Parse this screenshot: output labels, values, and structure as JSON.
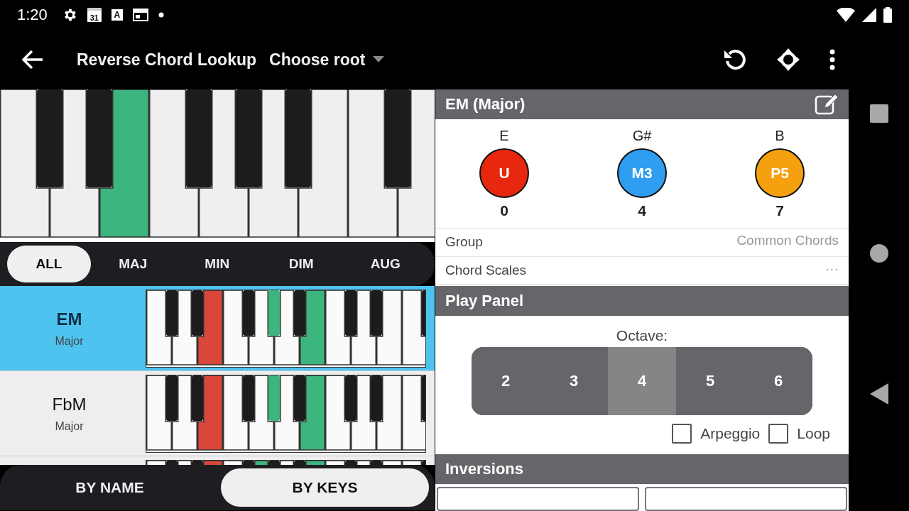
{
  "status_bar": {
    "time": "1:20",
    "calendar_day": "31",
    "keyboard_letter": "A"
  },
  "toolbar": {
    "title": "Reverse Chord Lookup",
    "root_dropdown": "Choose root"
  },
  "piano": {
    "keys": [
      {
        "kind": "white"
      },
      {
        "kind": "black"
      },
      {
        "kind": "white"
      },
      {
        "kind": "black"
      },
      {
        "kind": "white",
        "color": "#3db57f"
      },
      {
        "kind": "white"
      },
      {
        "kind": "black"
      },
      {
        "kind": "white"
      },
      {
        "kind": "black"
      },
      {
        "kind": "white"
      },
      {
        "kind": "black"
      },
      {
        "kind": "white"
      },
      {
        "kind": "white"
      },
      {
        "kind": "black"
      },
      {
        "kind": "white"
      }
    ]
  },
  "filter_tabs": [
    {
      "label": "ALL",
      "selected": true
    },
    {
      "label": "MAJ",
      "selected": false
    },
    {
      "label": "MIN",
      "selected": false
    },
    {
      "label": "DIM",
      "selected": false
    },
    {
      "label": "AUG",
      "selected": false
    }
  ],
  "chords": [
    {
      "name": "EM",
      "quality": "Major",
      "selected": true,
      "keys": [
        {
          "kind": "white"
        },
        {
          "kind": "black"
        },
        {
          "kind": "white"
        },
        {
          "kind": "black"
        },
        {
          "kind": "white",
          "color": "#d9473b"
        },
        {
          "kind": "white"
        },
        {
          "kind": "black"
        },
        {
          "kind": "white"
        },
        {
          "kind": "black",
          "color": "#3db57f"
        },
        {
          "kind": "white"
        },
        {
          "kind": "black"
        },
        {
          "kind": "white",
          "color": "#3db57f"
        },
        {
          "kind": "white"
        },
        {
          "kind": "black"
        },
        {
          "kind": "white"
        },
        {
          "kind": "black"
        },
        {
          "kind": "white"
        },
        {
          "kind": "white"
        },
        {
          "kind": "black"
        }
      ]
    },
    {
      "name": "FbM",
      "quality": "Major",
      "selected": false,
      "keys": [
        {
          "kind": "white"
        },
        {
          "kind": "black"
        },
        {
          "kind": "white"
        },
        {
          "kind": "black"
        },
        {
          "kind": "white",
          "color": "#d9473b"
        },
        {
          "kind": "white"
        },
        {
          "kind": "black"
        },
        {
          "kind": "white"
        },
        {
          "kind": "black",
          "color": "#3db57f"
        },
        {
          "kind": "white"
        },
        {
          "kind": "black"
        },
        {
          "kind": "white",
          "color": "#3db57f"
        },
        {
          "kind": "white"
        },
        {
          "kind": "black"
        },
        {
          "kind": "white"
        },
        {
          "kind": "black"
        },
        {
          "kind": "white"
        },
        {
          "kind": "white"
        },
        {
          "kind": "black"
        }
      ]
    },
    {
      "selected": false,
      "keys": [
        {
          "kind": "white"
        },
        {
          "kind": "black"
        },
        {
          "kind": "white"
        },
        {
          "kind": "black"
        },
        {
          "kind": "white",
          "color": "#d9473b"
        },
        {
          "kind": "white"
        },
        {
          "kind": "black"
        },
        {
          "kind": "white",
          "color": "#3db57f"
        },
        {
          "kind": "black"
        },
        {
          "kind": "white"
        },
        {
          "kind": "black"
        },
        {
          "kind": "white",
          "color": "#3db57f"
        },
        {
          "kind": "white"
        },
        {
          "kind": "black"
        },
        {
          "kind": "white"
        },
        {
          "kind": "black"
        },
        {
          "kind": "white"
        },
        {
          "kind": "white"
        },
        {
          "kind": "black"
        }
      ]
    }
  ],
  "view_toggle": [
    {
      "label": "BY NAME",
      "selected": false
    },
    {
      "label": "BY KEYS",
      "selected": true
    }
  ],
  "chord_details": {
    "title": "EM (Major)",
    "notes": [
      {
        "note": "E",
        "interval": "U",
        "semitones": "0",
        "color": "#e8280e"
      },
      {
        "note": "G#",
        "interval": "M3",
        "semitones": "4",
        "color": "#2f9df0"
      },
      {
        "note": "B",
        "interval": "P5",
        "semitones": "7",
        "color": "#f5a00f"
      }
    ],
    "properties": [
      {
        "label": "Group",
        "value": "Common Chords"
      },
      {
        "label": "Chord Scales",
        "value": "···"
      }
    ]
  },
  "play_panel": {
    "title": "Play Panel",
    "octave_label": "Octave:",
    "octaves": [
      {
        "label": "2",
        "selected": false
      },
      {
        "label": "3",
        "selected": false
      },
      {
        "label": "4",
        "selected": true
      },
      {
        "label": "5",
        "selected": false
      },
      {
        "label": "6",
        "selected": false
      }
    ],
    "options": [
      {
        "label": "Arpeggio",
        "checked": false
      },
      {
        "label": "Loop",
        "checked": false
      }
    ]
  },
  "inversions": {
    "title": "Inversions"
  }
}
